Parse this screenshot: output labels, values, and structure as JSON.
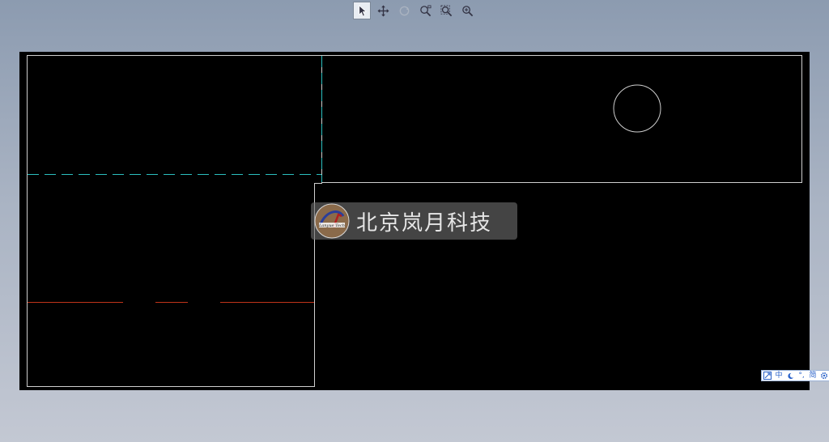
{
  "toolbar": {
    "tools": [
      {
        "name": "select",
        "icon": "cursor-arrow-icon",
        "active": true
      },
      {
        "name": "pan",
        "icon": "move-arrows-icon",
        "active": false
      },
      {
        "name": "rotate",
        "icon": "rotate-icon",
        "active": false,
        "disabled": true
      },
      {
        "name": "zoom-window",
        "icon": "zoom-window-icon",
        "active": false
      },
      {
        "name": "zoom-extents",
        "icon": "zoom-extents-icon",
        "active": false
      },
      {
        "name": "zoom-realtime",
        "icon": "zoom-realtime-icon",
        "active": false
      }
    ]
  },
  "watermark": {
    "logo_text": "Lanyue Tech",
    "text": "北京岚月科技"
  },
  "ime_bar": {
    "items": [
      {
        "icon": "ime-logo-icon",
        "label": ""
      },
      {
        "icon": "ime-chinese-mode",
        "label": "中"
      },
      {
        "icon": "moon-icon",
        "label": ""
      },
      {
        "icon": "punctuation-icon",
        "label": "°,"
      },
      {
        "icon": "simplified-icon",
        "label": "简"
      },
      {
        "icon": "gear-icon",
        "label": ""
      }
    ]
  },
  "colors": {
    "canvas_bg": "#000000",
    "outline": "#cfcfcf",
    "center_line": "#2bbfbf",
    "hidden_line": "#c0341a",
    "ime_blue": "#2a62c9"
  }
}
